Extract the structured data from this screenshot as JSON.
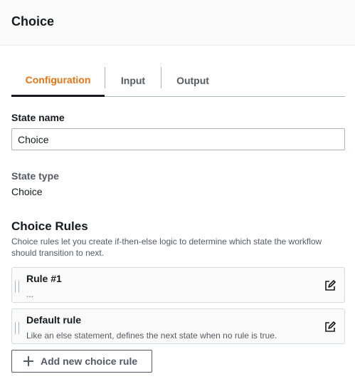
{
  "header": {
    "title": "Choice"
  },
  "tabs": [
    {
      "label": "Configuration",
      "active": true
    },
    {
      "label": "Input",
      "active": false
    },
    {
      "label": "Output",
      "active": false
    }
  ],
  "state_name": {
    "label": "State name",
    "value": "Choice"
  },
  "state_type": {
    "label": "State type",
    "value": "Choice"
  },
  "choice_rules": {
    "title": "Choice Rules",
    "description": "Choice rules let you create if-then-else logic to determine which state the workflow should transition to next.",
    "rules": [
      {
        "title": "Rule #1",
        "subtitle": "..."
      },
      {
        "title": "Default rule",
        "subtitle": "Like an else statement, defines the next state when no rule is true."
      }
    ],
    "add_button_label": "Add new choice rule"
  },
  "colors": {
    "accent": "#ec7211",
    "text": "#16191f",
    "muted": "#545b64",
    "border": "#aab7b8"
  },
  "icons": {
    "edit": "edit-icon",
    "plus": "plus-icon",
    "drag": "drag-handle-icon"
  }
}
